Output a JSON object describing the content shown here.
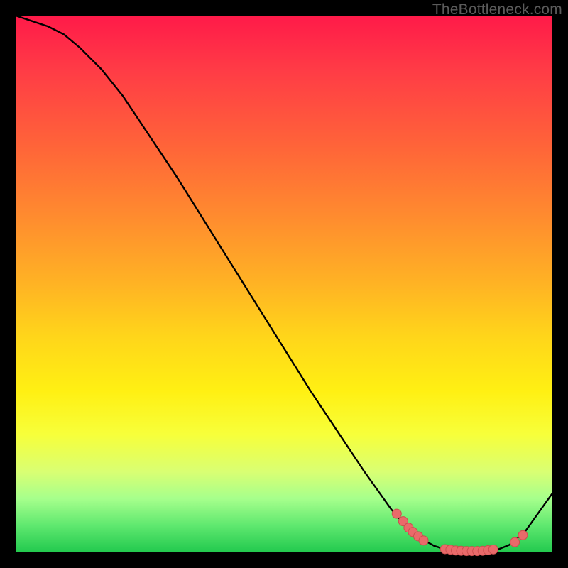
{
  "watermark": "TheBottleneck.com",
  "colors": {
    "curve": "#000000",
    "marker_fill": "#e96a6a",
    "marker_stroke": "#cc4e4e"
  },
  "chart_data": {
    "type": "line",
    "title": "",
    "xlabel": "",
    "ylabel": "",
    "xlim": [
      0,
      100
    ],
    "ylim": [
      0,
      100
    ],
    "x": [
      0,
      3,
      6,
      9,
      12,
      16,
      20,
      25,
      30,
      35,
      40,
      45,
      50,
      55,
      60,
      65,
      70,
      73,
      76,
      78,
      80,
      82,
      84,
      86,
      88,
      90,
      92,
      95,
      100
    ],
    "y": [
      100,
      99,
      98,
      96.5,
      94,
      90,
      85,
      77.5,
      70,
      62,
      54,
      46,
      38,
      30,
      22.5,
      15,
      8,
      4.5,
      2.3,
      1.2,
      0.6,
      0.3,
      0.2,
      0.2,
      0.3,
      0.6,
      1.4,
      4,
      11
    ],
    "markers": [
      {
        "x": 71,
        "y": 7.2
      },
      {
        "x": 72.2,
        "y": 5.8
      },
      {
        "x": 73.2,
        "y": 4.6
      },
      {
        "x": 74.0,
        "y": 3.8
      },
      {
        "x": 75.0,
        "y": 3.0
      },
      {
        "x": 76.0,
        "y": 2.2
      },
      {
        "x": 80.0,
        "y": 0.6
      },
      {
        "x": 81.0,
        "y": 0.5
      },
      {
        "x": 82.0,
        "y": 0.35
      },
      {
        "x": 83.0,
        "y": 0.3
      },
      {
        "x": 84.0,
        "y": 0.25
      },
      {
        "x": 85.0,
        "y": 0.25
      },
      {
        "x": 86.0,
        "y": 0.25
      },
      {
        "x": 87.0,
        "y": 0.3
      },
      {
        "x": 88.0,
        "y": 0.4
      },
      {
        "x": 89.0,
        "y": 0.55
      },
      {
        "x": 93.0,
        "y": 1.9
      },
      {
        "x": 94.5,
        "y": 3.2
      }
    ]
  }
}
